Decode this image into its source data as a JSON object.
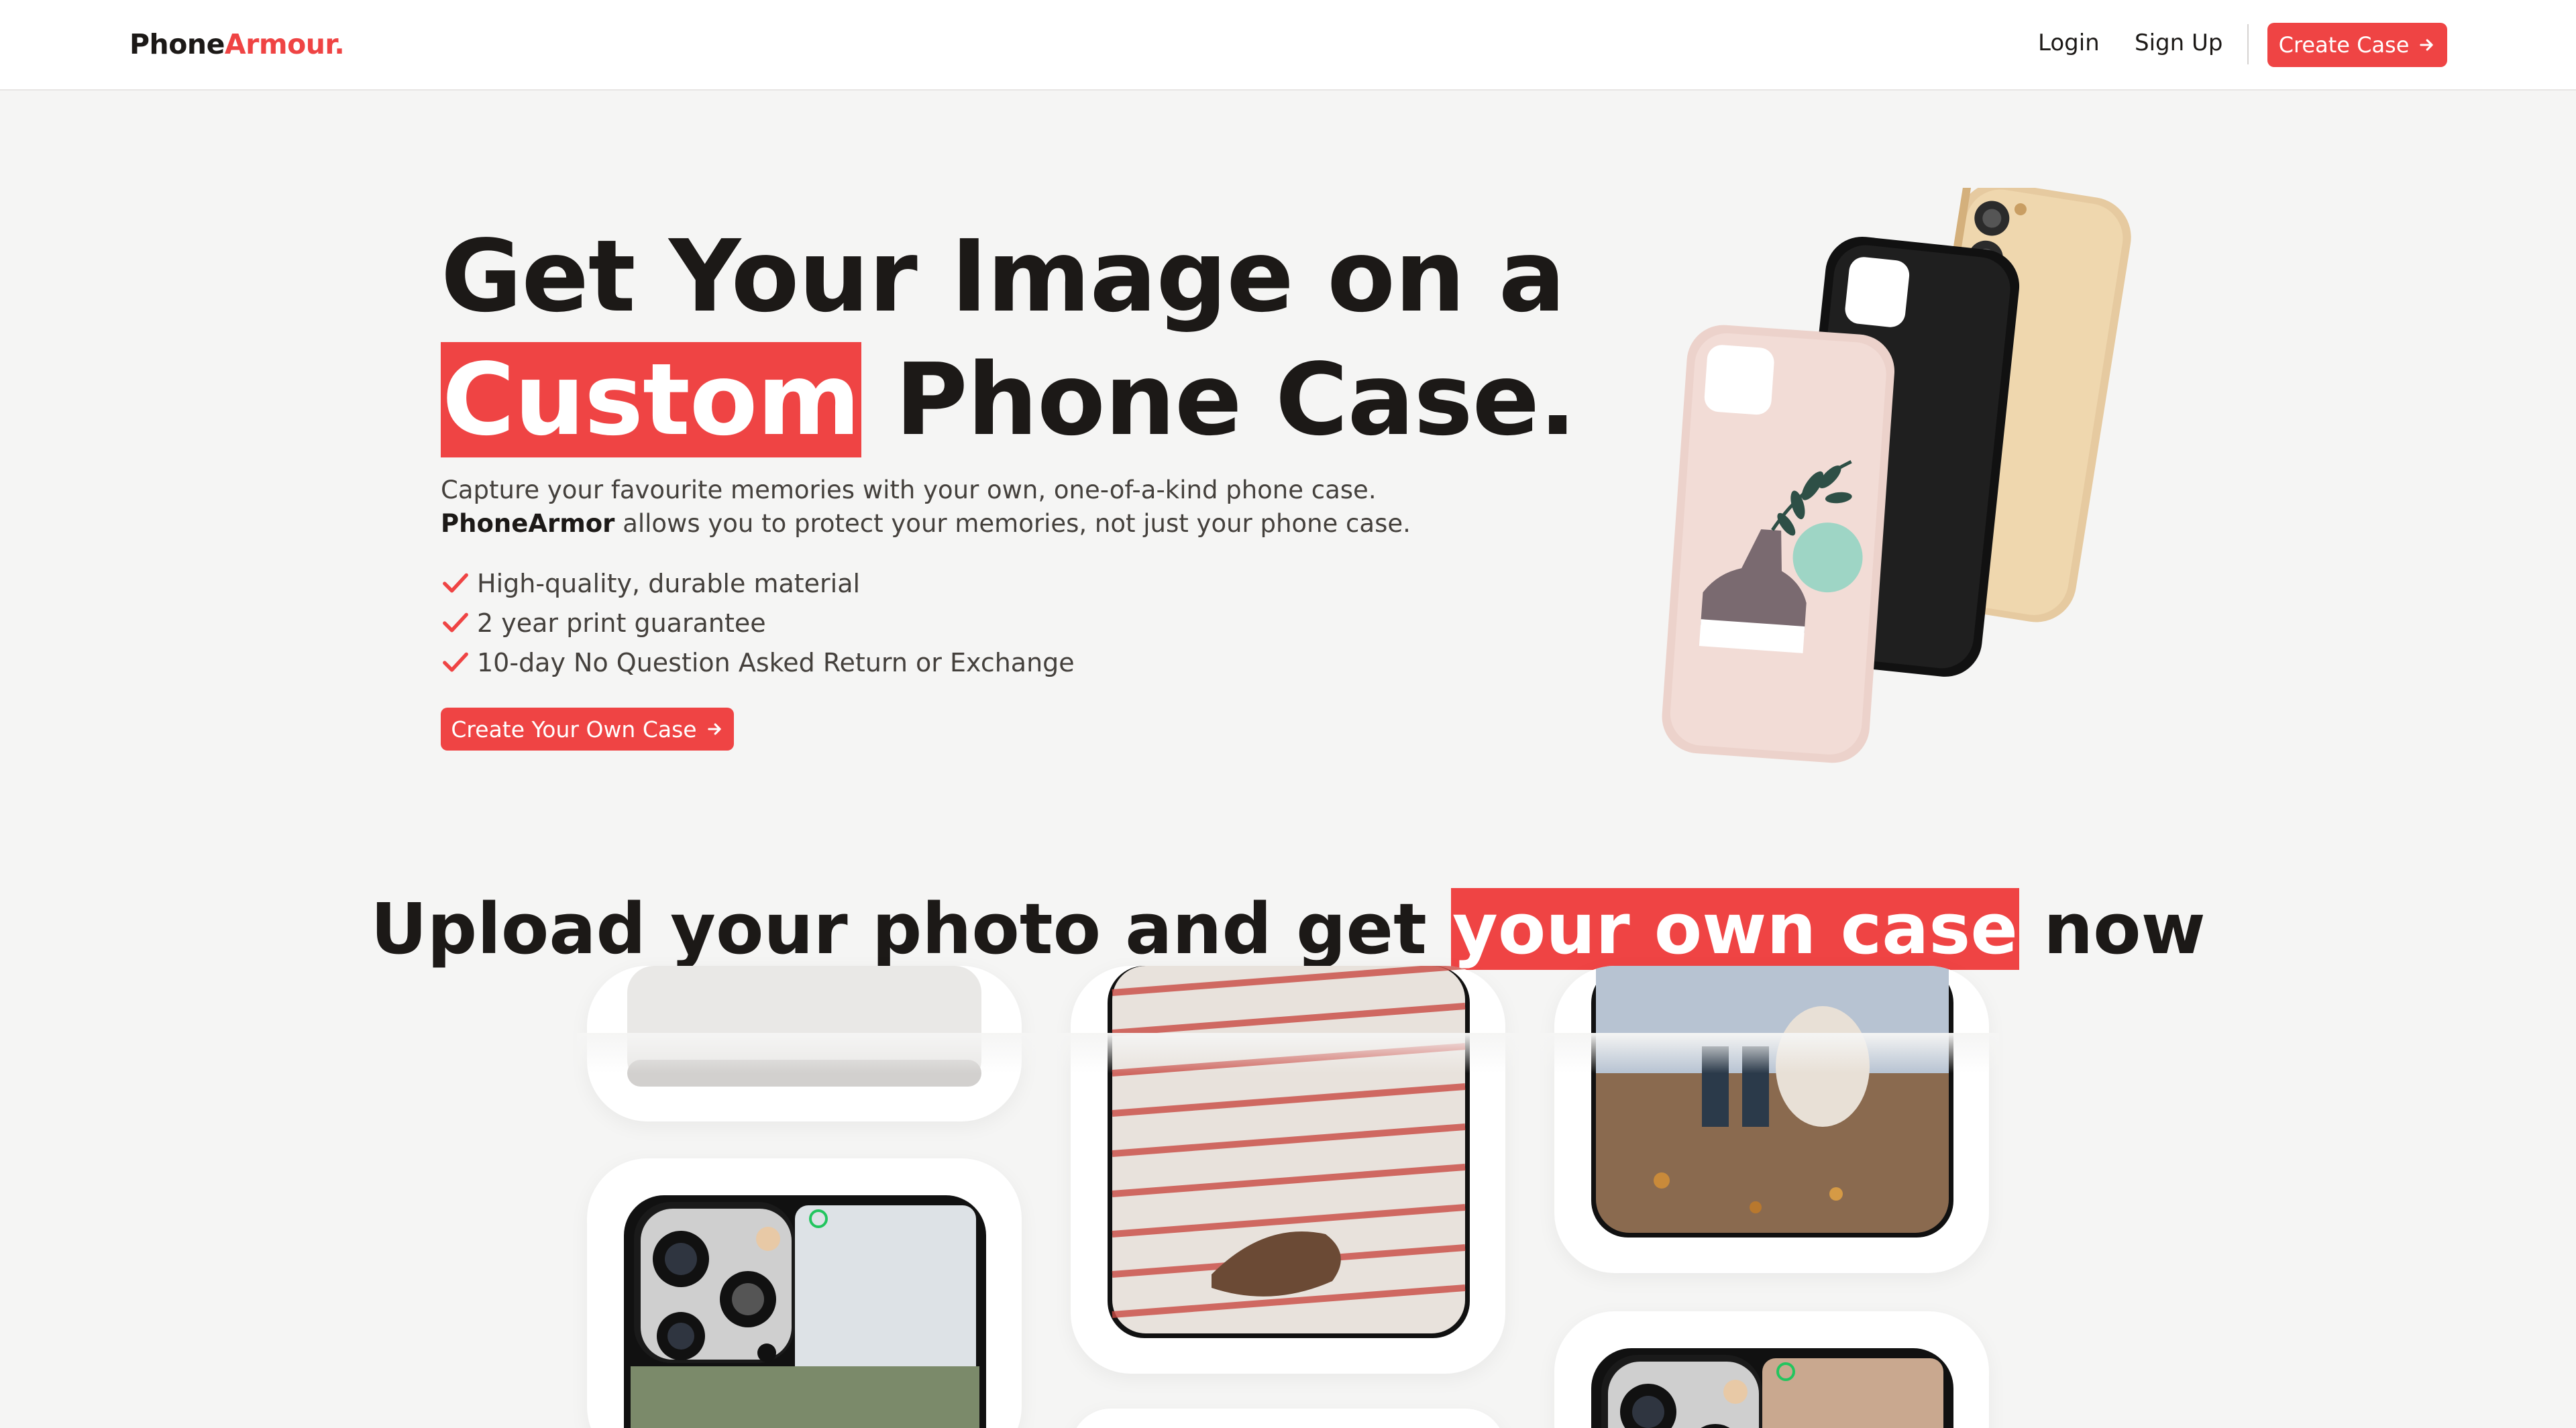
{
  "nav": {
    "logo_main": "Phone",
    "logo_accent": "Armour.",
    "login": "Login",
    "signup": "Sign Up",
    "cta": "Create Case",
    "cta_icon": "arrow-right-icon"
  },
  "hero": {
    "title_line1": "Get Your Image on a",
    "title_highlight": "Custom",
    "title_rest": "Phone Case.",
    "desc_pre": "Capture your favourite memories with your own, one-of-a-kind phone case.",
    "desc_brand": "PhoneArmor",
    "desc_post": "allows you to protect your memories, not just your phone case.",
    "features": [
      "High-quality, durable material",
      "2 year print guarantee",
      "10-day No Question Asked Return or Exchange"
    ],
    "cta": "Create Your Own Case",
    "cta_icon": "arrow-right-icon",
    "check_icon": "check-icon",
    "phones": [
      "pink-plant-case",
      "black-case",
      "gold-case"
    ]
  },
  "section": {
    "title_pre": "Upload your photo and get",
    "title_highlight": "your own case",
    "title_post": "now"
  },
  "colors": {
    "accent": "#ef4444",
    "background": "#f5f5f4",
    "text": "#1c1917"
  }
}
